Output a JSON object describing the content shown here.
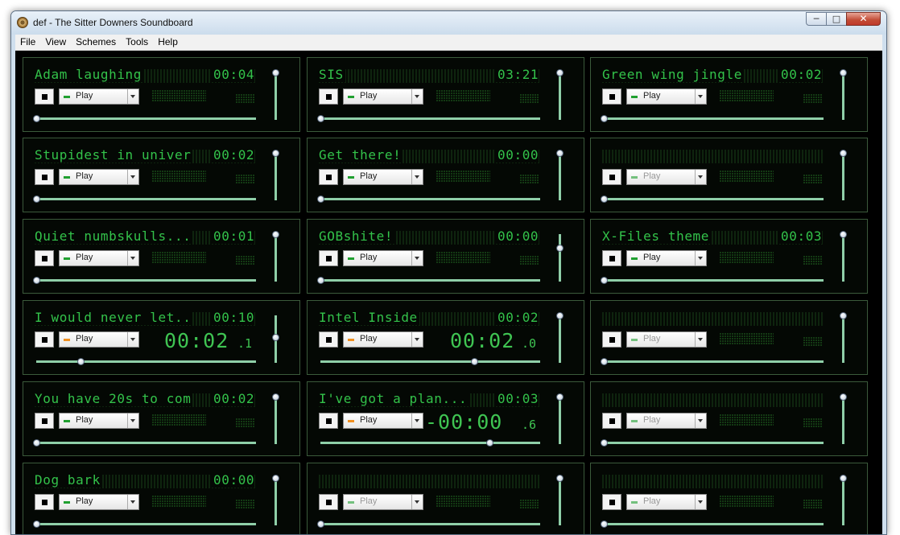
{
  "window": {
    "title": "def - The Sitter Downers Soundboard",
    "controls": {
      "minimize": "─",
      "maximize": "□",
      "close": "✕"
    }
  },
  "menu": [
    "File",
    "View",
    "Schemes",
    "Tools",
    "Help"
  ],
  "colors": {
    "lcd_text": "#33c24a",
    "lcd_dim": "#0e240e",
    "panel_bg": "#040804",
    "slider_track": "#8fcfa8",
    "indicator_idle": "#20a030",
    "indicator_playing": "#f09020"
  },
  "soundboard": {
    "panels": [
      {
        "name": "Adam laughing",
        "duration": "00:04",
        "play_label": "Play",
        "state": "idle",
        "enabled": true,
        "position": 0,
        "volume": 1
      },
      {
        "name": "SIS",
        "duration": "03:21",
        "play_label": "Play",
        "state": "idle",
        "enabled": true,
        "position": 0,
        "volume": 1
      },
      {
        "name": "Green wing jingle",
        "duration": "00:02",
        "play_label": "Play",
        "state": "idle",
        "enabled": true,
        "position": 0,
        "volume": 1
      },
      {
        "name": "Stupidest in univer",
        "duration": "00:02",
        "play_label": "Play",
        "state": "idle",
        "enabled": true,
        "position": 0,
        "volume": 1
      },
      {
        "name": "Get there!",
        "duration": "00:00",
        "play_label": "Play",
        "state": "idle",
        "enabled": true,
        "position": 0,
        "volume": 1
      },
      {
        "name": "",
        "duration": "",
        "play_label": "Play",
        "state": "idle",
        "enabled": false,
        "position": 0,
        "volume": 1
      },
      {
        "name": "Quiet numbskulls...",
        "duration": "00:01",
        "play_label": "Play",
        "state": "idle",
        "enabled": true,
        "position": 0,
        "volume": 1
      },
      {
        "name": "GOBshite!",
        "duration": "00:00",
        "play_label": "Play",
        "state": "idle",
        "enabled": true,
        "position": 0,
        "volume": 0.72
      },
      {
        "name": "X-Files theme",
        "duration": "00:03",
        "play_label": "Play",
        "state": "idle",
        "enabled": true,
        "position": 0,
        "volume": 1
      },
      {
        "name": "I would never let..",
        "duration": "00:10",
        "play_label": "Play",
        "state": "playing",
        "enabled": true,
        "elapsed": "00:02",
        "tenths": ".1",
        "position": 0.2,
        "volume": 0.55
      },
      {
        "name": "Intel Inside",
        "duration": "00:02",
        "play_label": "Play",
        "state": "playing",
        "enabled": true,
        "elapsed": "00:02",
        "tenths": ".0",
        "position": 0.7,
        "volume": 1
      },
      {
        "name": "",
        "duration": "",
        "play_label": "Play",
        "state": "idle",
        "enabled": false,
        "position": 0,
        "volume": 1
      },
      {
        "name": "You have 20s to com",
        "duration": "00:02",
        "play_label": "Play",
        "state": "idle",
        "enabled": true,
        "position": 0,
        "volume": 1
      },
      {
        "name": "I've got a plan...",
        "duration": "00:03",
        "play_label": "Play",
        "state": "playing",
        "enabled": true,
        "elapsed": "-00:00",
        "tenths": ".6",
        "position": 0.77,
        "volume": 1
      },
      {
        "name": "",
        "duration": "",
        "play_label": "Play",
        "state": "idle",
        "enabled": false,
        "position": 0,
        "volume": 1
      },
      {
        "name": "Dog bark",
        "duration": "00:00",
        "play_label": "Play",
        "state": "idle",
        "enabled": true,
        "position": 0,
        "volume": 1
      },
      {
        "name": "",
        "duration": "",
        "play_label": "Play",
        "state": "idle",
        "enabled": false,
        "position": 0,
        "volume": 1
      },
      {
        "name": "",
        "duration": "",
        "play_label": "Play",
        "state": "idle",
        "enabled": false,
        "position": 0,
        "volume": 1
      }
    ]
  }
}
